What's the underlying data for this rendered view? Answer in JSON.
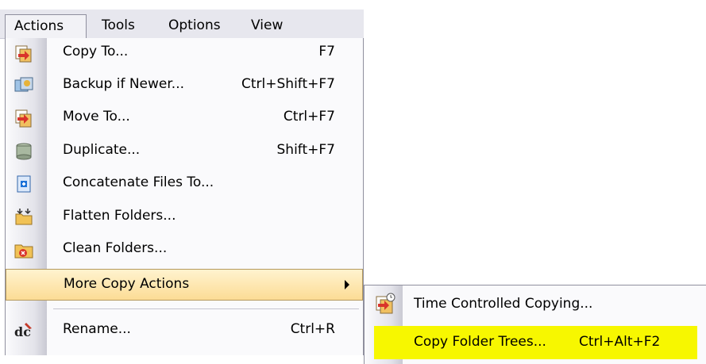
{
  "menubar": {
    "items": [
      {
        "label": "Actions"
      },
      {
        "label": "Tools"
      },
      {
        "label": "Options"
      },
      {
        "label": "View"
      }
    ]
  },
  "menu": {
    "items": [
      {
        "label": "Copy To...",
        "shortcut": "F7",
        "icon": "copy-to-icon"
      },
      {
        "label": "Backup if Newer...",
        "shortcut": "Ctrl+Shift+F7",
        "icon": "backup-icon"
      },
      {
        "label": "Move To...",
        "shortcut": "Ctrl+F7",
        "icon": "move-to-icon"
      },
      {
        "label": "Duplicate...",
        "shortcut": "Shift+F7",
        "icon": "duplicate-icon"
      },
      {
        "label": "Concatenate Files To...",
        "shortcut": "",
        "icon": "concatenate-icon"
      },
      {
        "label": "Flatten Folders...",
        "shortcut": "",
        "icon": "flatten-folders-icon"
      },
      {
        "label": "Clean Folders...",
        "shortcut": "",
        "icon": "clean-folders-icon"
      },
      {
        "label": "More Copy Actions",
        "shortcut": "",
        "icon": "",
        "submenu": true
      },
      {
        "label": "Rename...",
        "shortcut": "Ctrl+R",
        "icon": "rename-icon"
      }
    ]
  },
  "submenu": {
    "items": [
      {
        "label": "Time Controlled Copying...",
        "shortcut": "",
        "icon": "time-controlled-copy-icon"
      },
      {
        "label": "Copy Folder Trees...",
        "shortcut": "Ctrl+Alt+F2",
        "icon": ""
      }
    ]
  },
  "colors": {
    "hover": "#fcdc95",
    "highlight": "#f7f700",
    "menubar": "#e7e7ee"
  }
}
